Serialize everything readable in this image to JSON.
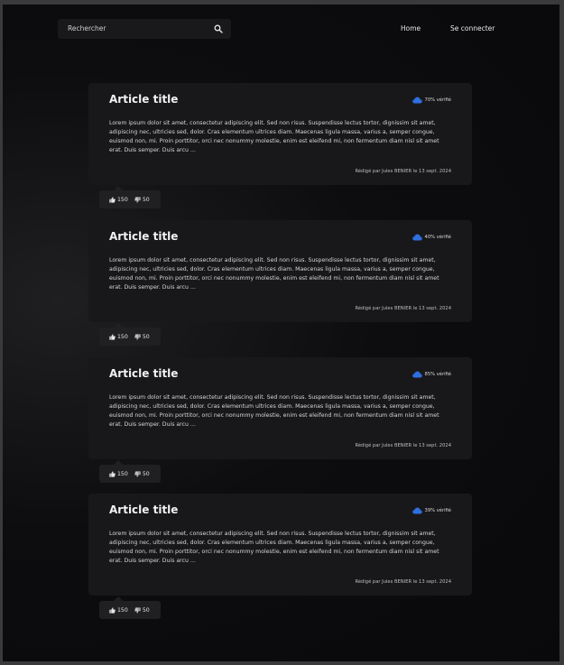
{
  "header": {
    "search_placeholder": "Rechercher",
    "nav": [
      "Home",
      "Se connecter"
    ]
  },
  "articles": [
    {
      "title": "Article title",
      "verified": "70% vérifié",
      "body": "Lorem ipsum  dolor sit amet, consectetur adipiscing elit. Sed non risus. Suspendisse  lectus tortor, dignissim sit amet, adipiscing nec, ultricies sed, dolor.  Cras elementum ultrices diam. Maecenas ligula massa, varius a, semper  congue, euismod non, mi. Proin porttitor, orci nec nonummy molestie,  enim est eleifend mi, non fermentum diam nisl sit amet erat. Duis  semper. Duis arcu ...",
      "meta": "Rédigé par Jules BENIER le 13 sept. 2024",
      "likes": "150",
      "dislikes": "50"
    },
    {
      "title": "Article title",
      "verified": "40% vérifié",
      "body": "Lorem ipsum  dolor sit amet, consectetur adipiscing elit. Sed non risus. Suspendisse  lectus tortor, dignissim sit amet, adipiscing nec, ultricies sed, dolor.  Cras elementum ultrices diam. Maecenas ligula massa, varius a, semper  congue, euismod non, mi. Proin porttitor, orci nec nonummy molestie,  enim est eleifend mi, non fermentum diam nisl sit amet erat. Duis  semper. Duis arcu ...",
      "meta": "Rédigé par Jules BENIER le 13 sept. 2024",
      "likes": "150",
      "dislikes": "50"
    },
    {
      "title": "Article title",
      "verified": "85% vérifié",
      "body": "Lorem ipsum  dolor sit amet, consectetur adipiscing elit. Sed non risus. Suspendisse  lectus tortor, dignissim sit amet, adipiscing nec, ultricies sed, dolor.  Cras elementum ultrices diam. Maecenas ligula massa, varius a, semper  congue, euismod non, mi. Proin porttitor, orci nec nonummy molestie,  enim est eleifend mi, non fermentum diam nisl sit amet erat. Duis  semper. Duis arcu ...",
      "meta": "Rédigé par Jules BENIER le 13 sept. 2024",
      "likes": "150",
      "dislikes": "50"
    },
    {
      "title": "Article title",
      "verified": "39% vérifié",
      "body": "Lorem ipsum  dolor sit amet, consectetur adipiscing elit. Sed non risus. Suspendisse  lectus tortor, dignissim sit amet, adipiscing nec, ultricies sed, dolor.  Cras elementum ultrices diam. Maecenas ligula massa, varius a, semper  congue, euismod non, mi. Proin porttitor, orci nec nonummy molestie,  enim est eleifend mi, non fermentum diam nisl sit amet erat. Duis  semper. Duis arcu ...",
      "meta": "Rédigé par Jules BENIER le 13 sept. 2024",
      "likes": "150",
      "dislikes": "50"
    }
  ],
  "icons": {
    "search": "search-icon",
    "verified": "cloud-icon",
    "like": "thumbs-up-icon",
    "dislike": "thumbs-down-icon"
  },
  "colors": {
    "accent": "#2f6fe0",
    "card_bg": "#18181b",
    "page_bg": "#0b0b0d"
  }
}
